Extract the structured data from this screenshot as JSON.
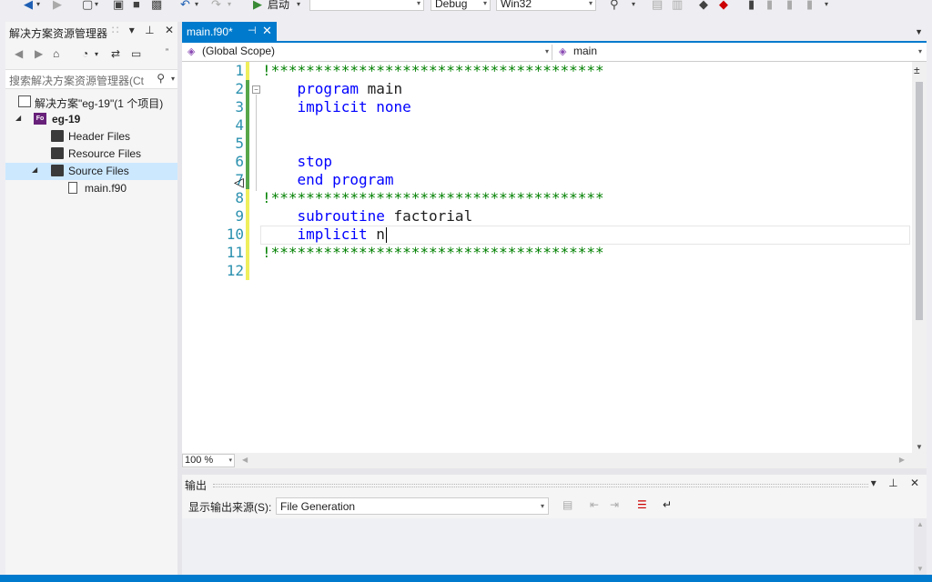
{
  "toolbar": {
    "start_label": "启动",
    "config": "Debug",
    "platform": "Win32",
    "blank_dropdown": ""
  },
  "solution_explorer": {
    "title": "解决方案资源管理器",
    "search_placeholder": "搜索解决方案资源管理器(Ct",
    "tree": [
      {
        "label": "解决方案\"eg-19\"(1 个项目)",
        "depth": 0,
        "type": "solution",
        "expanded": null
      },
      {
        "label": "eg-19",
        "depth": 0,
        "type": "project",
        "expanded": true,
        "bold": true
      },
      {
        "label": "Header Files",
        "depth": 1,
        "type": "folder",
        "expanded": null
      },
      {
        "label": "Resource Files",
        "depth": 1,
        "type": "folder",
        "expanded": null
      },
      {
        "label": "Source Files",
        "depth": 1,
        "type": "folder-open",
        "expanded": true,
        "selected": true
      },
      {
        "label": "main.f90",
        "depth": 2,
        "type": "file",
        "expanded": null
      }
    ]
  },
  "editor": {
    "tab_title": "main.f90*",
    "scope": "(Global Scope)",
    "member": "main",
    "zoom": "100 %",
    "lines": [
      {
        "n": "1",
        "text": "!**************************************",
        "kind": "comment"
      },
      {
        "n": "2",
        "text": "    program main",
        "kind": "code"
      },
      {
        "n": "3",
        "text": "    implicit none",
        "kind": "code"
      },
      {
        "n": "4",
        "text": "",
        "kind": "code"
      },
      {
        "n": "5",
        "text": "",
        "kind": "code"
      },
      {
        "n": "6",
        "text": "    stop",
        "kind": "code"
      },
      {
        "n": "7",
        "text": "    end program",
        "kind": "code"
      },
      {
        "n": "8",
        "text": "!**************************************",
        "kind": "comment"
      },
      {
        "n": "9",
        "text": "    subroutine factorial",
        "kind": "code"
      },
      {
        "n": "10",
        "text": "    implicit n",
        "kind": "code"
      },
      {
        "n": "11",
        "text": "!**************************************",
        "kind": "comment"
      },
      {
        "n": "12",
        "text": "",
        "kind": "code"
      }
    ]
  },
  "output": {
    "title": "输出",
    "source_label": "显示输出来源(S):",
    "source_value": "File Generation"
  },
  "colors": {
    "accent": "#007acc",
    "keyword": "#0000ff",
    "comment": "#008000",
    "line_number": "#2b91af",
    "saved_bar": "#57a64a",
    "unsaved_bar": "#efef5d"
  }
}
